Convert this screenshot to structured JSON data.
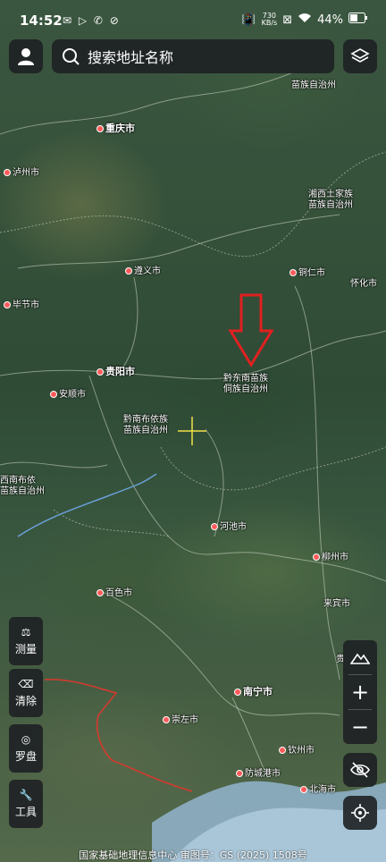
{
  "status_bar": {
    "time": "14:52",
    "net_speed_value": "730",
    "net_speed_unit": "KB/s",
    "battery": "44%"
  },
  "search": {
    "placeholder": "搜索地址名称"
  },
  "tools": {
    "measure": "测量",
    "clear": "清除",
    "compass": "罗盘",
    "tools": "工具"
  },
  "zoom": {
    "in": "+",
    "out": "−"
  },
  "map_labels": {
    "chongqing": "重庆市",
    "luzhou": "泸州市",
    "zunyi": "遵义市",
    "bijie": "毕节市",
    "guiyang": "贵阳市",
    "anshun": "安顺市",
    "qiannan_1": "黔南布依族",
    "qiannan_2": "苗族自治州",
    "qiandongnan_1": "黔东南苗族",
    "qiandongnan_2": "侗族自治州",
    "tongren": "铜仁市",
    "huaihua": "怀化市",
    "xiangxi_1": "湘西土家族",
    "xiangxi_2": "苗族自治州",
    "top_right": "苗族自治州",
    "qianxinan_1": "西南布依",
    "qianxinan_2": "苗族自治州",
    "hechi": "河池市",
    "liuzhou": "柳州市",
    "baise": "百色市",
    "laibin": "来宾市",
    "nanning": "南宁市",
    "chongzuo": "崇左市",
    "qinzhou": "钦州市",
    "fangchenggang": "防城港市",
    "beihai": "北海市",
    "gui": "贵"
  },
  "footer": "国家基础地理信息中心  审图号：GS (2025) 1508号"
}
